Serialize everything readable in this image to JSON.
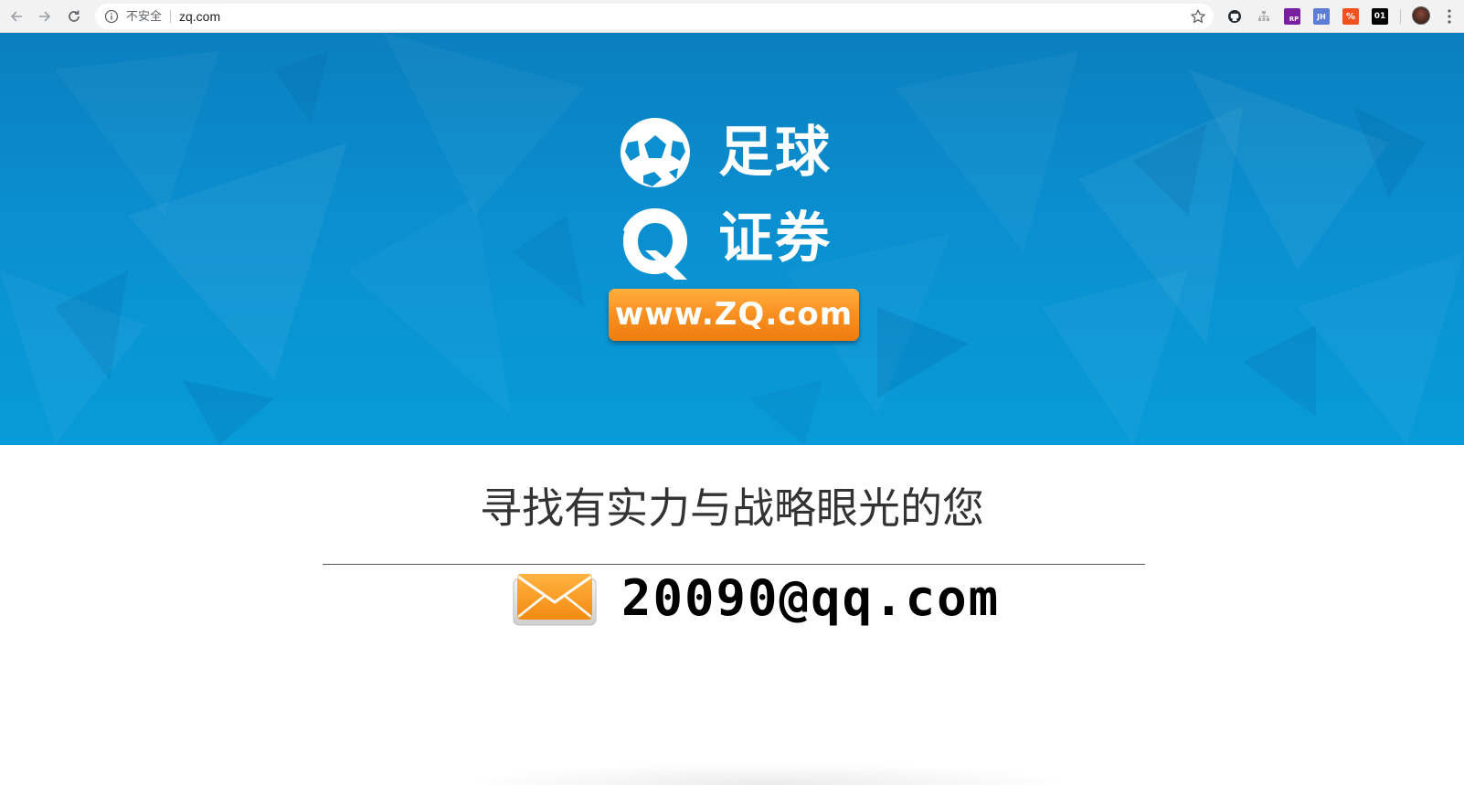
{
  "browser": {
    "security_label": "不安全",
    "url": "zq.com",
    "extensions": [
      {
        "name": "github-extension-icon",
        "label": ""
      },
      {
        "name": "sitemap-extension-icon",
        "label": ""
      },
      {
        "name": "rp-extension-icon",
        "label": "RP"
      },
      {
        "name": "jh-extension-icon",
        "label": "JH"
      },
      {
        "name": "percent-extension-icon",
        "label": "%"
      },
      {
        "name": "binary-extension-icon",
        "label": "01"
      }
    ]
  },
  "hero": {
    "logo_line1": "足球",
    "logo_line2": "证券",
    "url_button": "www.ZQ.com",
    "colors": {
      "banner": "#0a8fd0",
      "button": "#f78d1e"
    }
  },
  "content": {
    "tagline": "寻找有实力与战略眼光的您",
    "email": "20090@qq.com"
  }
}
